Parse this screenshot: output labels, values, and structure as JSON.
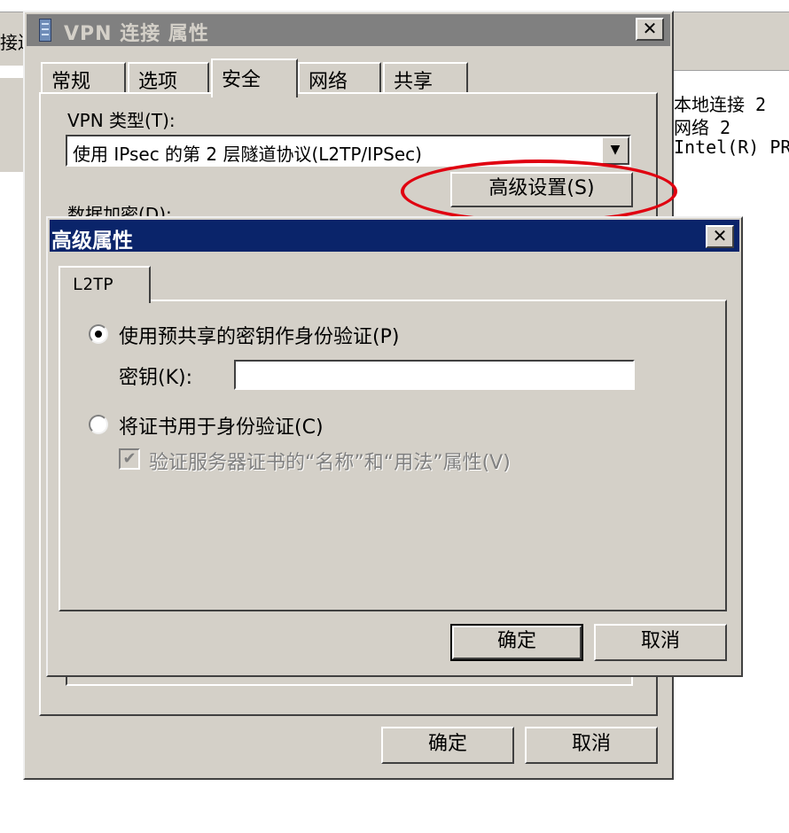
{
  "background": {
    "left_text": "接连",
    "right_lines": [
      "本地连接 2",
      "网络  2",
      "Intel(R) PR"
    ]
  },
  "vpn_window": {
    "title": "VPN 连接 属性",
    "tabs": [
      "常规",
      "选项",
      "安全",
      "网络",
      "共享"
    ],
    "active_tab": "安全",
    "vpn_type_label": "VPN 类型(T):",
    "vpn_type_value": "使用 IPsec 的第 2 层隧道协议(L2TP/IPSec)",
    "advanced_button": "高级设置(S)",
    "data_encryption_label": "数据加密(D):",
    "ok_button": "确定",
    "cancel_button": "取消"
  },
  "advanced_dialog": {
    "title": "高级属性",
    "tab": "L2TP",
    "option_psk": "使用预共享的密钥作身份验证(P)",
    "key_label": "密钥(K):",
    "key_value": "",
    "option_cert": "将证书用于身份验证(C)",
    "verify_cert_label": "验证服务器证书的“名称”和“用法”属性(V)",
    "ok_button": "确定",
    "cancel_button": "取消",
    "psk_selected": true,
    "verify_checked": true
  },
  "colors": {
    "dialog_title_active": "#0a246a",
    "window_title_inactive": "#808080",
    "face": "#d4d0c8",
    "highlight_ellipse": "#e00010"
  }
}
